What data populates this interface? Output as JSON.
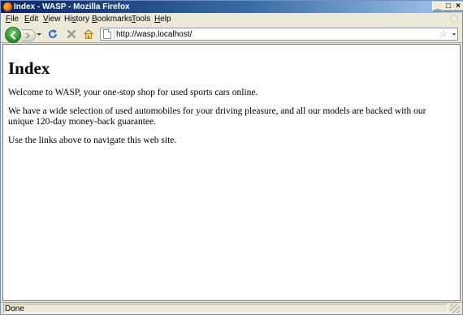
{
  "window": {
    "title": "Index - WASP - Mozilla Firefox",
    "controls": {
      "minimize": "_",
      "maximize": "□",
      "close": "×"
    }
  },
  "menubar": {
    "items": [
      {
        "accel": "F",
        "rest": "ile"
      },
      {
        "accel": "E",
        "rest": "dit"
      },
      {
        "accel": "V",
        "rest": "iew"
      },
      {
        "pre": "Hi",
        "accel": "s",
        "rest": "tory"
      },
      {
        "accel": "B",
        "rest": "ookmarks"
      },
      {
        "accel": "T",
        "rest": "ools"
      },
      {
        "accel": "H",
        "rest": "elp"
      }
    ]
  },
  "navbar": {
    "url": "http://wasp.localhost/",
    "bookmark_glyph": "☆"
  },
  "page": {
    "heading": "Index",
    "paragraphs": [
      "Welcome to WASP, your one-stop shop for used sports cars online.",
      "We have a wide selection of used automobiles for your driving pleasure, and all our models are backed with our unique 120-day money-back guarantee.",
      "Use the links above to navigate this web site."
    ]
  },
  "statusbar": {
    "text": "Done"
  },
  "colors": {
    "titlebar_start": "#0a246a",
    "titlebar_end": "#a6caf0",
    "chrome": "#ece9d8",
    "back_button": "#2a8a2a",
    "reload_icon": "#3a6fc9",
    "stop_icon": "#9a9a9a"
  }
}
